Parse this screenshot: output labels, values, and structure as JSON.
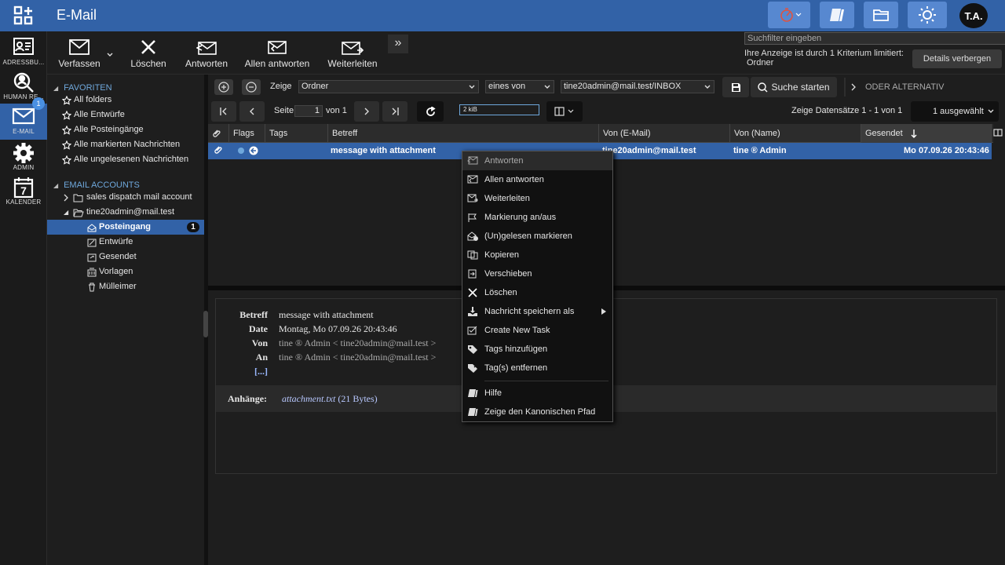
{
  "topbar": {
    "title": "E-Mail",
    "avatar": "T.A.",
    "icons": [
      "app-grid-icon",
      "timer-icon",
      "book-icon",
      "folder-icon",
      "brightness-icon"
    ]
  },
  "leftnav": {
    "items": [
      {
        "label": "ADRESSBU..."
      },
      {
        "label": "HUMAN RE..."
      },
      {
        "label": "E-MAIL",
        "badge": "1"
      },
      {
        "label": "ADMIN"
      },
      {
        "label": "KALENDER",
        "day": "7"
      }
    ]
  },
  "toolbar": {
    "compose": "Verfassen",
    "delete": "Löschen",
    "reply": "Antworten",
    "reply_all": "Allen antworten",
    "forward": "Weiterleiten",
    "more": "»"
  },
  "search": {
    "placeholder": "Suchfilter eingeben",
    "note": "Ihre Anzeige ist durch 1 Kriterium limitiert:",
    "note_field": "Ordner",
    "details_button": "Details verbergen"
  },
  "tree": {
    "favorites_title": "FAVORITEN",
    "favorites": [
      "All folders",
      "Alle Entwürfe",
      "Alle Posteingänge",
      "Alle markierten Nachrichten",
      "Alle ungelesenen Nachrichten"
    ],
    "accounts_title": "EMAIL ACCOUNTS",
    "account1": "sales dispatch mail account",
    "account2": "tine20admin@mail.test",
    "folders": [
      {
        "name": "Posteingang",
        "count": "1"
      },
      {
        "name": "Entwürfe"
      },
      {
        "name": "Gesendet"
      },
      {
        "name": "Vorlagen"
      },
      {
        "name": "Mülleimer"
      }
    ]
  },
  "filter": {
    "show_label": "Zeige",
    "field": "Ordner",
    "operator": "eines von",
    "value": "tine20admin@mail.test/INBOX",
    "search_button": "Suche starten",
    "alt_label": "ODER ALTERNATIV"
  },
  "pager": {
    "page_label": "Seite",
    "page_value": "1",
    "of_label": "von 1",
    "filesize": "2 kiB",
    "records": "Zeige Datensätze 1 - 1 von 1",
    "selected": "1 ausgewählt"
  },
  "grid": {
    "columns": [
      "Flags",
      "Tags",
      "Betreff",
      "Von (E-Mail)",
      "Von (Name)",
      "Gesendet"
    ],
    "row": {
      "subject": "message with attachment",
      "from_email": "tine20admin@mail.test",
      "from_name": "tine ® Admin",
      "sent": "Mo 07.09.26 20:43:46"
    }
  },
  "preview": {
    "subject_label": "Betreff",
    "subject": "message with attachment",
    "date_label": "Date",
    "date": "Montag, Mo 07.09.26 20:43:46",
    "from_label": "Von",
    "from": "tine ® Admin < tine20admin@mail.test >",
    "to_label": "An",
    "to": "tine ® Admin < tine20admin@mail.test >",
    "more": "[...]",
    "attachments_label": "Anhänge:",
    "attachment_name": "attachment.txt",
    "attachment_size": "(21 Bytes)"
  },
  "context_menu": {
    "items": [
      "Antworten",
      "Allen antworten",
      "Weiterleiten",
      "Markierung an/aus",
      "(Un)gelesen markieren",
      "Kopieren",
      "Verschieben",
      "Löschen",
      "Nachricht speichern als",
      "Create New Task",
      "Tags hinzufügen",
      "Tag(s) entfernen",
      "Hilfe",
      "Zeige den Kanonischen Pfad"
    ]
  },
  "colors": {
    "brand": "#3262a7",
    "accent_light": "#5788d0",
    "background": "#1e1e1e"
  }
}
